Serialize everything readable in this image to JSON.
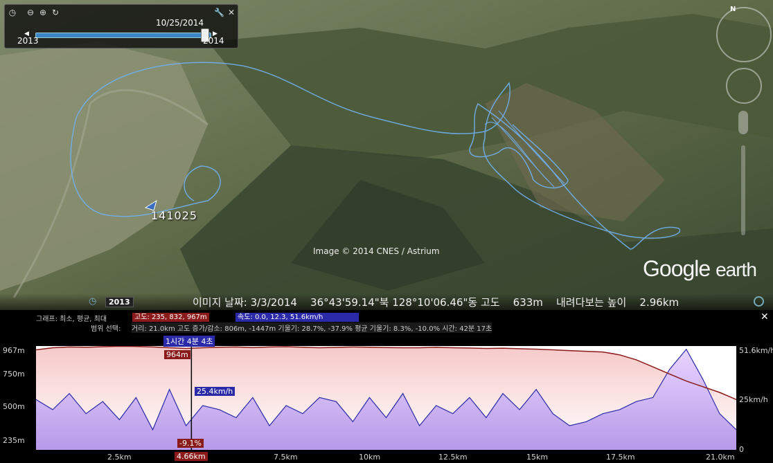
{
  "timeslider": {
    "current_date": "10/25/2014",
    "start_label": "2013",
    "end_label": "2014",
    "position_fraction": 0.97
  },
  "tools": {
    "wrench_icon": "wrench-icon",
    "close_icon": "close-icon"
  },
  "map": {
    "attribution": "Image © 2014 CNES / Astrium",
    "logo_google": "Google",
    "logo_earth": "earth",
    "placemark_label": "141025",
    "track_color": "#6fb0f0"
  },
  "statusbar": {
    "year": "2013",
    "info": "이미지 날짜: 3/3/2014    36°43'59.14\"북 128°10'06.46\"동 고도    633m    내려다보는 높이    2.96km"
  },
  "profile": {
    "row1_label": "그래프: 최소, 평균, 최대",
    "elev_stats": "고도: 235, 832, 967m",
    "speed_stats": "속도: 0.0, 12.3, 51.6km/h",
    "row2_label": "범위 선택:",
    "row2_text": "거리: 21.0km 고도 증가/감소: 806m, -1447m 기울기: 28.7%, -37.9% 평균 기울기: 8.3%, -10.0% 시간: 42분 17초",
    "time_flag": "1시간 4분 4초",
    "elev_flag": "964m",
    "speed_flag": "25.4km/h",
    "slope_flag": "-9.1%",
    "dist_flag": "4.66km",
    "y_left": [
      "967m",
      "750m",
      "500m",
      "235m"
    ],
    "y_right": [
      "51.6km/h",
      "25km/h",
      "0"
    ],
    "x_ticks": [
      "2.5km",
      "7.5km",
      "10km",
      "12.5km",
      "15km",
      "17.5km",
      "21.0km"
    ],
    "elev_color": "#8b1a1a",
    "speed_color": "#2a2aa8"
  },
  "chart_data": {
    "type": "area",
    "xlabel": "",
    "ylabel": "",
    "xlim": [
      0,
      21.0
    ],
    "x": [
      0,
      0.5,
      1,
      1.5,
      2,
      2.5,
      3,
      3.5,
      4,
      4.5,
      5,
      5.5,
      6,
      6.5,
      7,
      7.5,
      8,
      8.5,
      9,
      9.5,
      10,
      10.5,
      11,
      11.5,
      12,
      12.5,
      13,
      13.5,
      14,
      14.5,
      15,
      15.5,
      16,
      16.5,
      17,
      17.5,
      18,
      18.5,
      19,
      19.5,
      20,
      20.5,
      21
    ],
    "series": [
      {
        "values": [
          940,
          955,
          960,
          958,
          962,
          965,
          964,
          960,
          955,
          950,
          955,
          958,
          960,
          956,
          960,
          962,
          958,
          955,
          957,
          960,
          958,
          956,
          955,
          955,
          958,
          955,
          953,
          950,
          952,
          948,
          945,
          940,
          935,
          930,
          925,
          905,
          870,
          820,
          770,
          720,
          680,
          640,
          590
        ],
        "ylim": [
          235,
          967
        ]
      },
      {
        "values": [
          25,
          20,
          28,
          18,
          24,
          15,
          26,
          10,
          30,
          12,
          22,
          20,
          16,
          26,
          12,
          22,
          18,
          26,
          24,
          14,
          26,
          16,
          28,
          12,
          22,
          18,
          26,
          16,
          28,
          20,
          30,
          18,
          12,
          14,
          18,
          20,
          24,
          26,
          40,
          50,
          35,
          18,
          10
        ],
        "ylim": [
          0,
          51.6
        ]
      }
    ]
  }
}
